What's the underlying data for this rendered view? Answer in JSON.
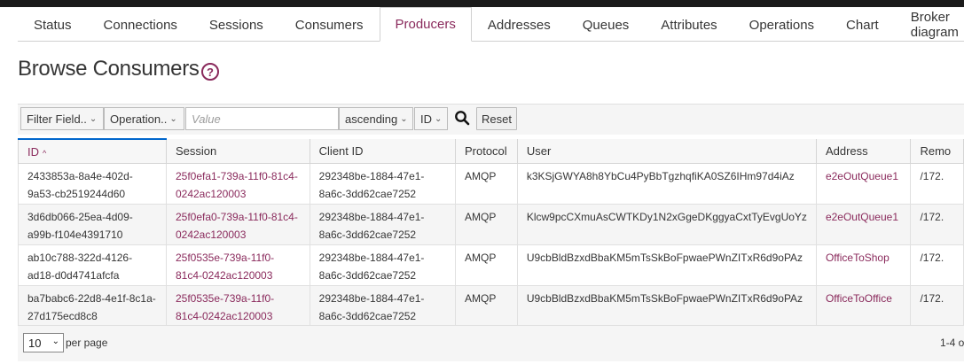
{
  "tabs": [
    {
      "label": "Status"
    },
    {
      "label": "Connections"
    },
    {
      "label": "Sessions"
    },
    {
      "label": "Consumers"
    },
    {
      "label": "Producers",
      "active": true
    },
    {
      "label": "Addresses"
    },
    {
      "label": "Queues"
    },
    {
      "label": "Attributes"
    },
    {
      "label": "Operations"
    },
    {
      "label": "Chart"
    },
    {
      "label": "Broker diagram"
    }
  ],
  "page": {
    "title": "Browse Consumers",
    "help_icon": "question-circle-icon"
  },
  "filter": {
    "field_label": "Filter Field..",
    "operation_label": "Operation..",
    "value_placeholder": "Value",
    "sort_order": "ascending",
    "sort_field": "ID",
    "search_icon": "search-icon",
    "reset_label": "Reset"
  },
  "table": {
    "columns": [
      "ID",
      "Session",
      "Client ID",
      "Protocol",
      "User",
      "Address",
      "Remo"
    ],
    "sorted_column": "ID",
    "rows": [
      {
        "id": "2433853a-8a4e-402d-9a53-cb2519244d60",
        "session": "25f0efa1-739a-11f0-81c4-0242ac120003",
        "client_id": "292348be-1884-47e1-8a6c-3dd62cae7252",
        "protocol": "AMQP",
        "user": "k3KSjGWYA8h8YbCu4PyBbTgzhqfiKA0SZ6IHm97d4iAz",
        "address": "e2eOutQueue1",
        "remote": "/172."
      },
      {
        "id": "3d6db066-25ea-4d09-a99b-f104e4391710",
        "session": "25f0efa0-739a-11f0-81c4-0242ac120003",
        "client_id": "292348be-1884-47e1-8a6c-3dd62cae7252",
        "protocol": "AMQP",
        "user": "Klcw9pcCXmuAsCWTKDy1N2xGgeDKggyaCxtTyEvgUoYz",
        "address": "e2eOutQueue1",
        "remote": "/172."
      },
      {
        "id": "ab10c788-322d-4126-ad18-d0d4741afcfa",
        "session": "25f0535e-739a-11f0-81c4-0242ac120003",
        "client_id": "292348be-1884-47e1-8a6c-3dd62cae7252",
        "protocol": "AMQP",
        "user": "U9cbBldBzxdBbaKM5mTsSkBoFpwaePWnZITxR6d9oPAz",
        "address": "OfficeToShop",
        "remote": "/172."
      },
      {
        "id": "ba7babc6-22d8-4e1f-8c1a-27d175ecd8c8",
        "session": "25f0535e-739a-11f0-81c4-0242ac120003",
        "client_id": "292348be-1884-47e1-8a6c-3dd62cae7252",
        "protocol": "AMQP",
        "user": "U9cbBldBzxdBbaKM5mTsSkBoFpwaePWnZITxR6d9oPAz",
        "address": "OfficeToOffice",
        "remote": "/172."
      }
    ]
  },
  "pagination": {
    "per_page": "10",
    "per_page_label": "per page",
    "range_text": "1-4 o"
  },
  "colors": {
    "accent": "#8a2a5c",
    "sort_indicator": "#0066cc",
    "topbar": "#1b1b1b"
  }
}
